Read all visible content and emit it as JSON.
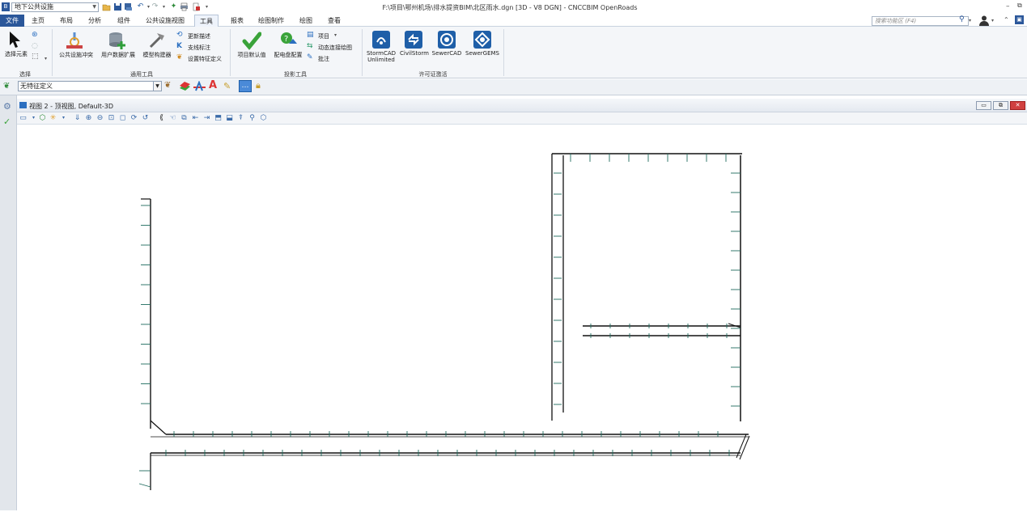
{
  "titlebar": {
    "workspace": "地下公共设施",
    "title": "F:\\项目\\鄂州机场\\排水提资BIM\\北区雨水.dgn [3D - V8 DGN] - CNCCBIM OpenRoads",
    "min_icon": "minimize-icon",
    "restore_icon": "restore-icon"
  },
  "menu": {
    "tabs": [
      "文件",
      "主页",
      "布局",
      "分析",
      "组件",
      "公共设施视图",
      "工具",
      "报表",
      "绘图制作",
      "绘图",
      "查看"
    ],
    "active": "工具",
    "search_placeholder": "搜索功能区 (F4)"
  },
  "ribbon": {
    "select_group": {
      "label": "选择",
      "select_button": "选择元素"
    },
    "general_group": {
      "label": "通用工具",
      "buttons": [
        "公共设施冲突",
        "用户数据扩展",
        "模型构建器"
      ],
      "small": [
        "更新描述",
        "支线标注",
        "设置特征定义"
      ]
    },
    "projection_group": {
      "label": "投影工具",
      "buttons": [
        "项目默认值",
        "配电盘配置"
      ],
      "small": [
        "项目",
        "动态连接绘图",
        "批注"
      ]
    },
    "license_group": {
      "label": "许可证激活",
      "buttons": [
        "StormCAD Unlimited",
        "CivilStorm",
        "SewerCAD",
        "SewerGEMS"
      ]
    }
  },
  "feature": {
    "selected": "无特征定义"
  },
  "view": {
    "title": "视图 2 - 顶视图, Default-3D"
  },
  "colors": {
    "file_tab": "#2b579a",
    "pipe": "#111111",
    "node": "#1e6b5e"
  }
}
